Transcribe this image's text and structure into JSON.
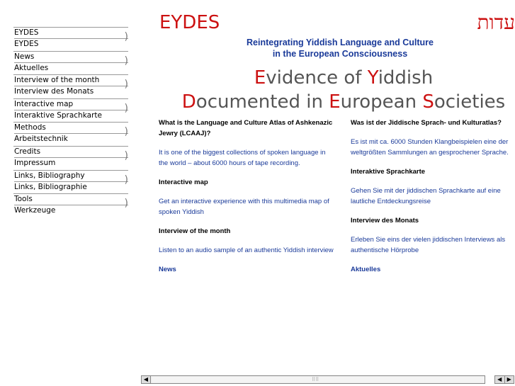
{
  "nav": {
    "items": [
      {
        "en": "EYDES",
        "de": "EYDES"
      },
      {
        "en": "News",
        "de": "Aktuelles"
      },
      {
        "en": "Interview of the month",
        "de": "Interview des Monats"
      },
      {
        "en": "Interactive map",
        "de": "Interaktive Sprachkarte"
      },
      {
        "en": "Methods",
        "de": "Arbeitstechnik"
      },
      {
        "en": "Credits",
        "de": "Impressum"
      },
      {
        "en": "Links, Bibliography",
        "de": "Links, Bibliographie"
      },
      {
        "en": "Tools",
        "de": "Werkzeuge"
      }
    ]
  },
  "header": {
    "logo": "EYDES",
    "hebrew": "עדות",
    "subtitle_line1": "Reintegrating Yiddish Language and Culture",
    "subtitle_line2": "in the European Consciousness",
    "headline": {
      "e1": "E",
      "r1": "vidence of ",
      "y1": "Y",
      "r2": "iddish",
      "d1": "D",
      "r3": "ocumented in ",
      "e2": "E",
      "r4": "uropean ",
      "s1": "S",
      "r5": "ocieties"
    }
  },
  "left": {
    "q1": "What is the Language and Culture Atlas of Ashkenazic Jewry (LCAAJ)?",
    "a1": "It is one of the biggest collections of spoken language in the world – about 6000 hours of tape recording.",
    "h2": "Interactive map",
    "a2": "Get an interactive experience with this multimedia map of spoken Yiddish",
    "h3": "Interview of the month",
    "a3": "Listen to an audio sample of an authentic Yiddish interview",
    "h4": "News"
  },
  "right": {
    "q1": "Was ist der Jiddische Sprach- und Kulturatlas?",
    "a1": "Es ist mit ca. 6000 Stunden Klangbeispielen eine der weltgrößten Sammlungen an gesprochener Sprache.",
    "h2": "Interaktive Sprachkarte",
    "a2": "Gehen Sie mit der jiddischen Sprachkarte auf eine lautliche Entdeckungsreise",
    "h3": "Interview des Monats",
    "a3": "Erleben Sie eins der vielen jiddischen Interviews als authentische Hörprobe",
    "h4": "Aktuelles"
  },
  "colors": {
    "red": "#cc1111",
    "blue": "#1a3a99"
  }
}
